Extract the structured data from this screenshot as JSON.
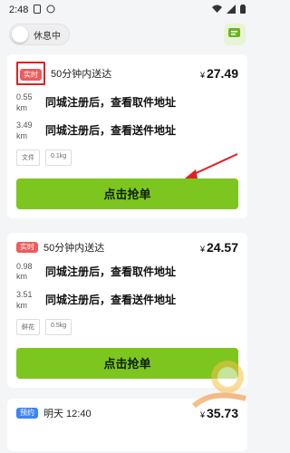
{
  "status_bar": {
    "time": "2:48"
  },
  "header": {
    "toggle_label": "休息中"
  },
  "orders": [
    {
      "badge": "实时",
      "time_label": "50分钟内送达",
      "price_symbol": "¥",
      "price": "27.49",
      "pickup_distance": "0.55 km",
      "pickup_address": "同城注册后，查看取件地址",
      "delivery_distance": "3.49 km",
      "delivery_address": "同城注册后，查看送件地址",
      "tags": [
        "文件",
        "0.1kg"
      ],
      "button_label": "点击抢单"
    },
    {
      "badge": "实时",
      "time_label": "50分钟内送达",
      "price_symbol": "¥",
      "price": "24.57",
      "pickup_distance": "0.98 km",
      "pickup_address": "同城注册后，查看取件地址",
      "delivery_distance": "3.51 km",
      "delivery_address": "同城注册后，查看送件地址",
      "tags": [
        "鲜花",
        "0.5kg"
      ],
      "button_label": "点击抢单"
    },
    {
      "badge": "预约",
      "time_label": "明天 12:40",
      "price_symbol": "¥",
      "price": "35.73"
    }
  ],
  "colors": {
    "accent_green": "#7cc61f",
    "badge_red": "#ef5b5b",
    "badge_blue": "#3d83f5",
    "highlight_red": "#e02020"
  },
  "icons": {
    "status_left": [
      "sim-icon",
      "battery-saver-icon"
    ],
    "status_right": [
      "wifi-icon",
      "signal-icon",
      "battery-icon"
    ],
    "header_right": "ticket-icon"
  }
}
